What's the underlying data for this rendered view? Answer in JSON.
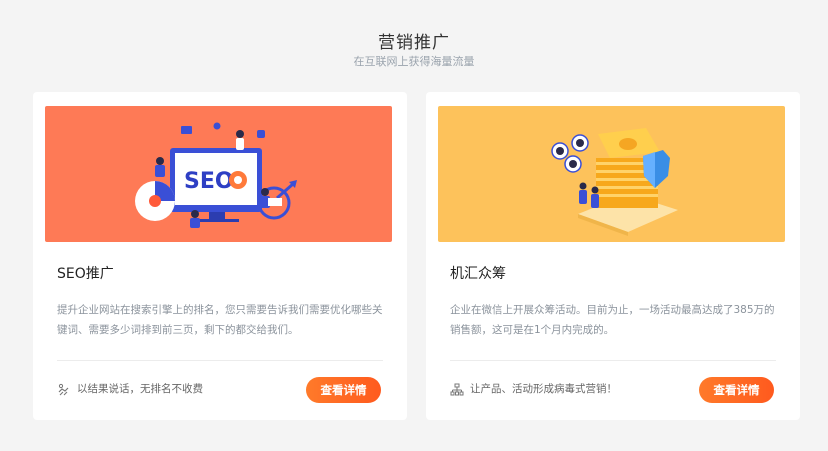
{
  "header": {
    "title": "营销推广",
    "subtitle": "在互联网上获得海量流量"
  },
  "cards": [
    {
      "banner_color": "#fe7a56",
      "banner_text": "SEO",
      "title": "SEO推广",
      "description": "提升企业网站在搜索引擎上的排名，您只需要告诉我们需要优化哪些关键词、需要多少词排到前三页，剩下的都交给我们。",
      "footer_icon": "handshake-icon",
      "footer_text": "以结果说话，无排名不收费",
      "button_label": "查看详情"
    },
    {
      "banner_color": "#fdc25b",
      "title": "机汇众筹",
      "description": "企业在微信上开展众筹活动。目前为止，一场活动最高达成了385万的销售额，这可是在1个月内完成的。",
      "footer_icon": "network-icon",
      "footer_text": "让产品、活动形成病毒式营销！",
      "button_label": "查看详情"
    }
  ],
  "colors": {
    "button": "#ff6a22",
    "seo_banner": "#fe7a56",
    "crowdfund_banner": "#fdc25b"
  }
}
